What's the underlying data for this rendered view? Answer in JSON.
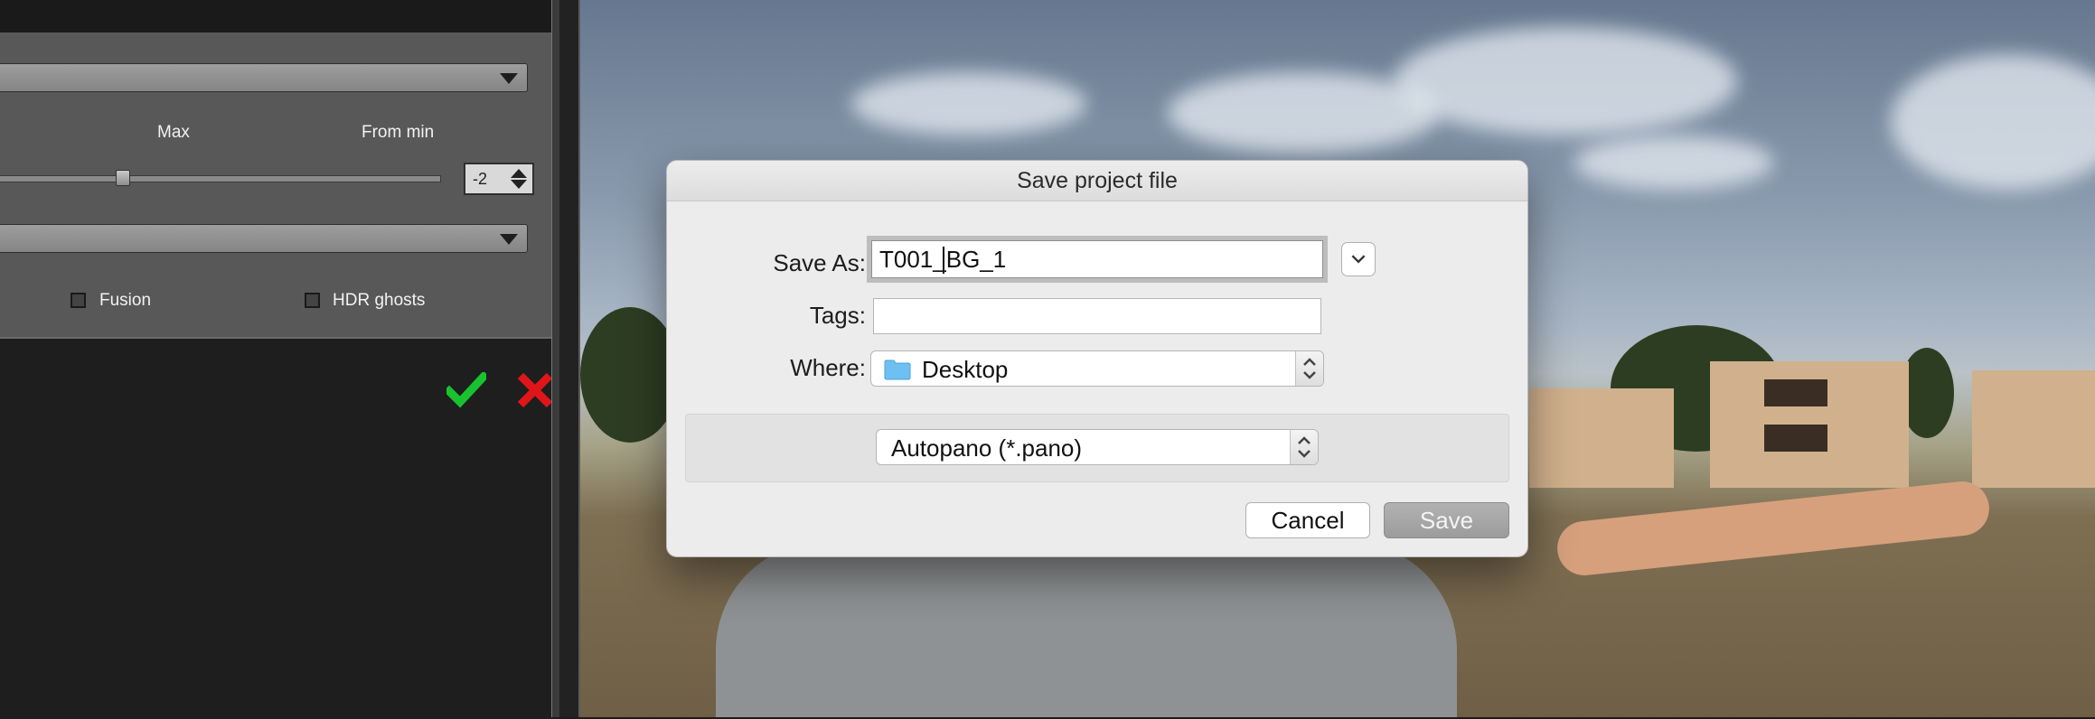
{
  "left_panel": {
    "labels": {
      "max": "Max",
      "from_min": "From min"
    },
    "spin_value": "-2",
    "checkboxes": [
      {
        "label": "Fusion",
        "checked": false
      },
      {
        "label": "HDR ghosts",
        "checked": false
      }
    ],
    "accept_icon_color": "#19c22f",
    "reject_icon_color": "#e0151a"
  },
  "dialog": {
    "title": "Save project file",
    "save_as_label": "Save As:",
    "save_as_value": "T001_BG_1",
    "tags_label": "Tags:",
    "tags_value": "",
    "where_label": "Where:",
    "where_value": "Desktop",
    "format_value": "Autopano (*.pano)",
    "cancel_label": "Cancel",
    "save_label": "Save"
  }
}
